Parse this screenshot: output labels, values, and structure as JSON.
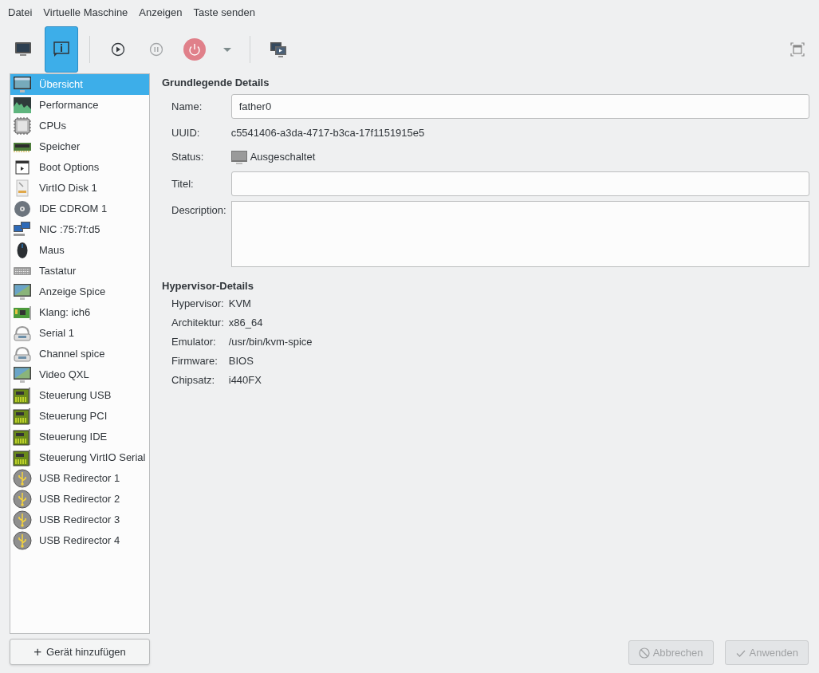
{
  "menu": [
    "Datei",
    "Virtuelle Maschine",
    "Anzeigen",
    "Taste senden"
  ],
  "toolbar": [
    {
      "kind": "console",
      "selected": false,
      "disabled": false
    },
    {
      "kind": "details",
      "selected": true,
      "disabled": false
    },
    {
      "kind": "separator"
    },
    {
      "kind": "run",
      "selected": false,
      "disabled": false
    },
    {
      "kind": "pause",
      "selected": false,
      "disabled": true
    },
    {
      "kind": "power",
      "selected": false,
      "disabled": false
    },
    {
      "kind": "dropdown",
      "selected": false,
      "disabled": false
    },
    {
      "kind": "separator"
    },
    {
      "kind": "snapshots",
      "selected": false,
      "disabled": false
    }
  ],
  "sidebar": {
    "items": [
      {
        "label": "Übersicht",
        "kind": "overview",
        "selected": true
      },
      {
        "label": "Performance",
        "kind": "performance",
        "selected": false
      },
      {
        "label": "CPUs",
        "kind": "cpu",
        "selected": false
      },
      {
        "label": "Speicher",
        "kind": "memory",
        "selected": false
      },
      {
        "label": "Boot Options",
        "kind": "boot",
        "selected": false
      },
      {
        "label": "VirtIO Disk 1",
        "kind": "disk",
        "selected": false
      },
      {
        "label": "IDE CDROM 1",
        "kind": "cdrom",
        "selected": false
      },
      {
        "label": "NIC :75:7f:d5",
        "kind": "nic",
        "selected": false
      },
      {
        "label": "Maus",
        "kind": "mouse",
        "selected": false
      },
      {
        "label": "Tastatur",
        "kind": "keyboard",
        "selected": false
      },
      {
        "label": "Anzeige Spice",
        "kind": "display",
        "selected": false
      },
      {
        "label": "Klang: ich6",
        "kind": "sound",
        "selected": false
      },
      {
        "label": "Serial 1",
        "kind": "serial",
        "selected": false
      },
      {
        "label": "Channel spice",
        "kind": "serial",
        "selected": false
      },
      {
        "label": "Video QXL",
        "kind": "display",
        "selected": false
      },
      {
        "label": "Steuerung USB",
        "kind": "controller",
        "selected": false
      },
      {
        "label": "Steuerung PCI",
        "kind": "controller",
        "selected": false
      },
      {
        "label": "Steuerung IDE",
        "kind": "controller",
        "selected": false
      },
      {
        "label": "Steuerung VirtIO Serial",
        "kind": "controller",
        "selected": false
      },
      {
        "label": "USB Redirector 1",
        "kind": "usb",
        "selected": false
      },
      {
        "label": "USB Redirector 2",
        "kind": "usb",
        "selected": false
      },
      {
        "label": "USB Redirector 3",
        "kind": "usb",
        "selected": false
      },
      {
        "label": "USB Redirector 4",
        "kind": "usb",
        "selected": false
      }
    ],
    "add_button": {
      "icon": "+",
      "label": "Gerät hinzufügen"
    }
  },
  "sections": [
    {
      "title": "Grundlegende Details",
      "fields": [
        {
          "label": "Name:",
          "kind": "input",
          "value": "father0"
        },
        {
          "label": "UUID:",
          "kind": "text",
          "value": "c5541406-a3da-4717-b3ca-17f1151915e5"
        },
        {
          "label": "Status:",
          "kind": "status",
          "value": "Ausgeschaltet"
        },
        {
          "label": "Titel:",
          "kind": "input"
        },
        {
          "label": "Description:",
          "kind": "textarea"
        }
      ]
    },
    {
      "title": "Hypervisor-Details",
      "fields": [
        {
          "label": "Hypervisor:",
          "kind": "text",
          "value": "KVM"
        },
        {
          "label": "Architektur:",
          "kind": "text",
          "value": "x86_64"
        },
        {
          "label": "Emulator:",
          "kind": "text",
          "value": "/usr/bin/kvm-spice"
        },
        {
          "label": "Firmware:",
          "kind": "text",
          "value": "BIOS"
        },
        {
          "label": "Chipsatz:",
          "kind": "text",
          "value": "i440FX"
        }
      ]
    }
  ],
  "buttons": [
    {
      "label": "Abbrechen",
      "kind": "cancel",
      "disabled": true
    },
    {
      "label": "Anwenden",
      "kind": "apply",
      "disabled": true
    }
  ]
}
